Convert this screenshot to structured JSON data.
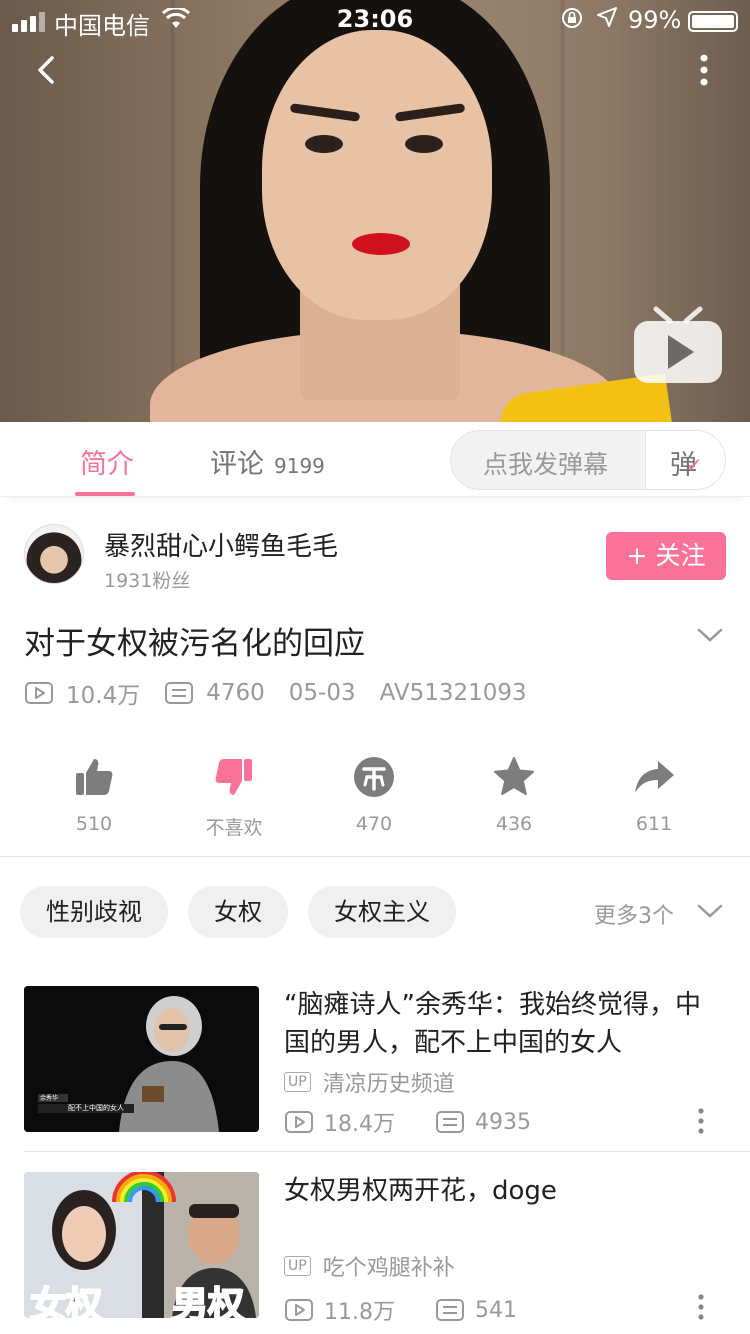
{
  "status_bar": {
    "carrier": "中国电信",
    "time": "23:06",
    "battery_pct_label": "99%",
    "battery_level": 0.99
  },
  "tabs": {
    "intro_label": "简介",
    "comment_label": "评论",
    "comment_count": "9199",
    "danmu_placeholder": "点我发弹幕",
    "danmu_button": "弹"
  },
  "uploader": {
    "name": "暴烈甜心小鳄鱼毛毛",
    "fans": "1931粉丝",
    "follow_label": "+ 关注"
  },
  "video": {
    "title": "对于女权被污名化的回应",
    "views": "10.4万",
    "danmaku": "4760",
    "date": "05-03",
    "av": "AV51321093"
  },
  "actions": {
    "like": "510",
    "dislike": "不喜欢",
    "coin": "470",
    "favorite": "436",
    "share": "611"
  },
  "tags": {
    "items": [
      "性别歧视",
      "女权",
      "女权主义"
    ],
    "more": "更多3个"
  },
  "related": [
    {
      "title": "“脑瘫诗人”余秀华：我始终觉得，中国的男人，配不上中国的女人",
      "up_badge": "UP",
      "up": "清凉历史频道",
      "views": "18.4万",
      "danmaku": "4935",
      "thumb_caption_1": "余秀华",
      "thumb_caption_2": "配不上中国的女人"
    },
    {
      "title": "女权男权两开花，doge",
      "up_badge": "UP",
      "up": "吃个鸡腿补补",
      "views": "11.8万",
      "danmaku": "541",
      "thumb_left_text": "女权",
      "thumb_right_text": "男权"
    }
  ],
  "colors": {
    "accent": "#fb7299",
    "muted": "#999999"
  }
}
